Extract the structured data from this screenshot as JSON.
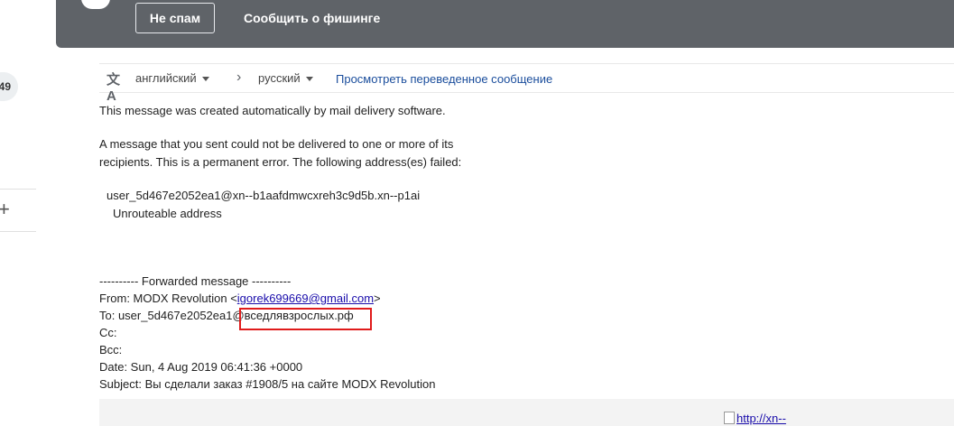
{
  "rail": {
    "badge": "49"
  },
  "toolbar": {
    "not_spam": "Не спам",
    "report_phishing": "Сообщить о фишинге"
  },
  "translate": {
    "from_lang": "английский",
    "to_lang": "русский",
    "view_translated": "Просмотреть переведенное сообщение"
  },
  "message": {
    "line1": "This message was created automatically by mail delivery software.",
    "line2": "A message that you sent could not be delivered to one or more of its",
    "line3": "recipients. This is a permanent error. The following address(es) failed:",
    "failed_address": "user_5d467e2052ea1@xn--b1aafdmwcxreh3c9d5b.xn--p1ai",
    "failed_reason": "Unrouteable address",
    "fwd_header": "---------- Forwarded message ----------",
    "from_prefix": "From: MODX Revolution <",
    "from_email": "igorek699669@gmail.com",
    "from_suffix": ">",
    "to_prefix": "To: user_5d467e2052ea1@",
    "to_domain": "вседлявзрослых.рф",
    "cc": "Cc:",
    "bcc": "Bcc:",
    "date": "Date: Sun, 4 Aug 2019 06:41:36 +0000",
    "subject": "Subject: Вы сделали заказ #1908/5 на сайте MODX Revolution",
    "image_alt": "http://xn--"
  },
  "colors": {
    "topbar": "#5f6368",
    "highlight": "#e01b1b",
    "link": "#1a0dab"
  }
}
